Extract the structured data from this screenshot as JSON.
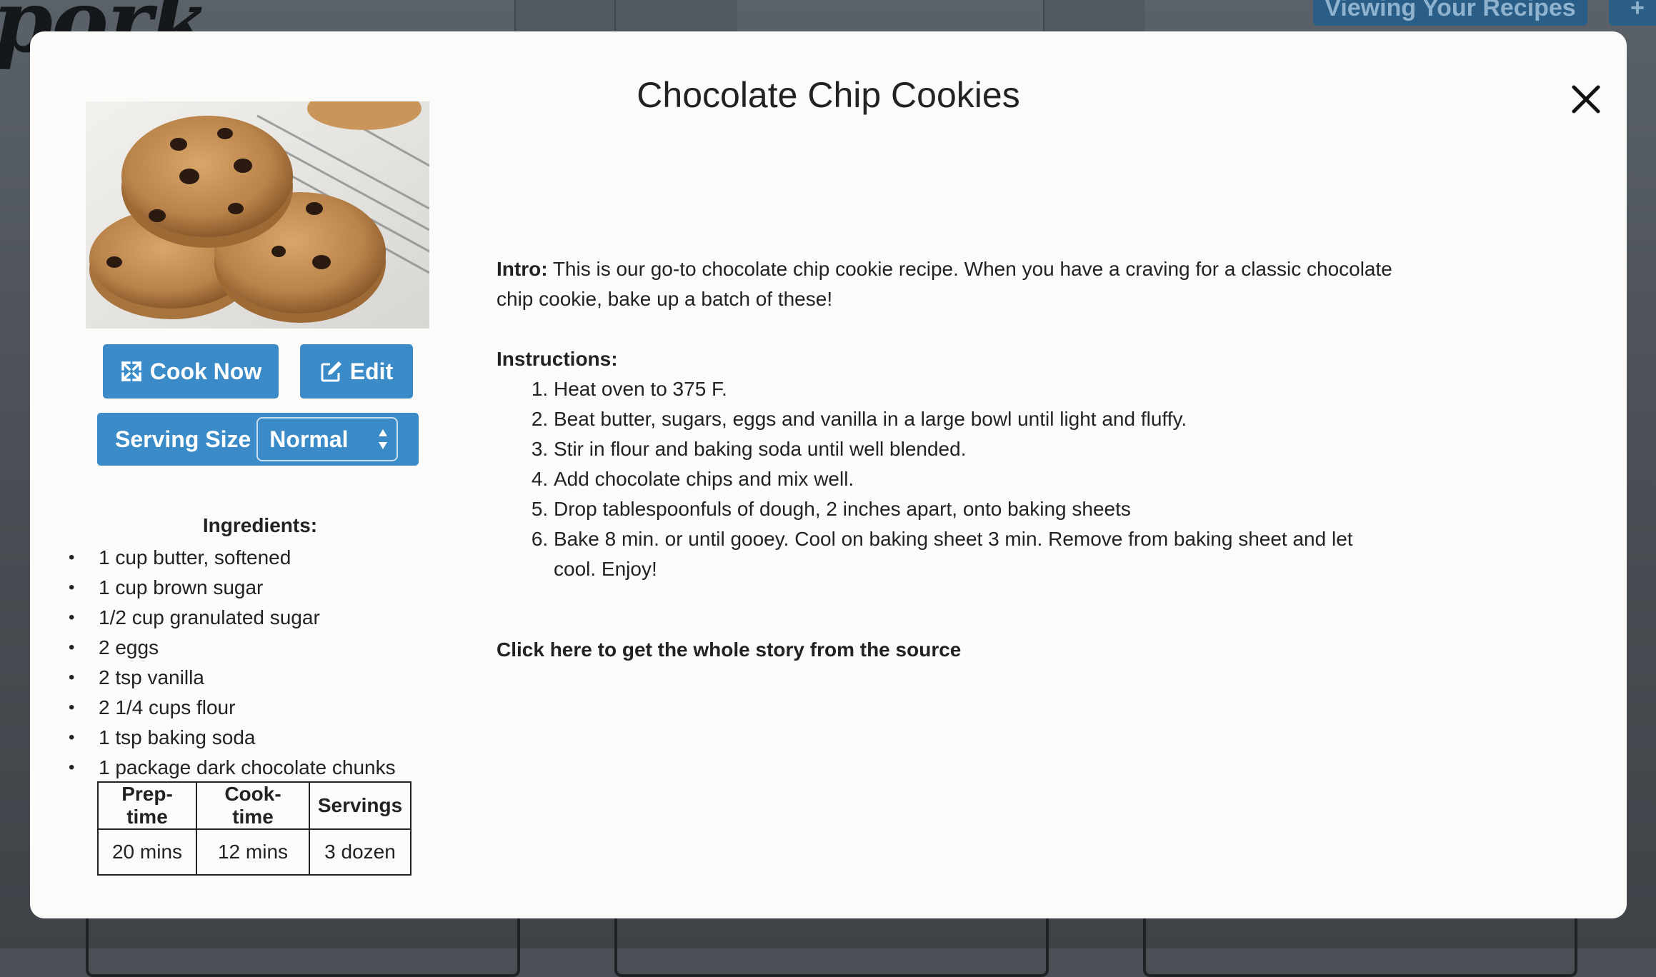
{
  "background": {
    "logo_text": "pork",
    "header_button": "Viewing Your Recipes",
    "add_button": "+"
  },
  "modal": {
    "title": "Chocolate Chip Cookies",
    "close_icon": "close-icon"
  },
  "actions": {
    "cook_now": "Cook Now",
    "cook_now_icon": "expand-icon",
    "edit": "Edit",
    "edit_icon": "edit-icon"
  },
  "serving_size": {
    "label": "Serving Size",
    "selected": "Normal"
  },
  "ingredients": {
    "title": "Ingredients:",
    "items": [
      "1 cup butter, softened",
      "1 cup brown sugar",
      "1/2 cup granulated sugar",
      "2 eggs",
      "2 tsp vanilla",
      "2 1/4 cups flour",
      "1 tsp baking soda",
      "1 package dark chocolate chunks"
    ]
  },
  "times": {
    "headers": [
      "Prep-time",
      "Cook-time",
      "Servings"
    ],
    "values": [
      "20 mins",
      "12 mins",
      "3 dozen"
    ]
  },
  "intro": {
    "label": "Intro:",
    "text": "This is our go-to chocolate chip cookie recipe. When you have a craving for a classic chocolate chip cookie, bake up a batch of these!"
  },
  "instructions": {
    "title": "Instructions:",
    "steps": [
      "Heat oven to 375 F.",
      "Beat butter, sugars, eggs and vanilla in a large bowl until light and fluffy.",
      "Stir in flour and baking soda until well blended.",
      "Add chocolate chips and mix well.",
      "Drop tablespoonfuls of dough, 2 inches apart, onto baking sheets",
      "Bake 8 min. or until gooey. Cool on baking sheet 3 min. Remove from baking sheet and let cool. Enjoy!"
    ]
  },
  "source_link": "Click here to get the whole story from the source",
  "colors": {
    "accent": "#3a8bc7",
    "modal_bg": "#fbfbf9",
    "text": "#222222"
  }
}
